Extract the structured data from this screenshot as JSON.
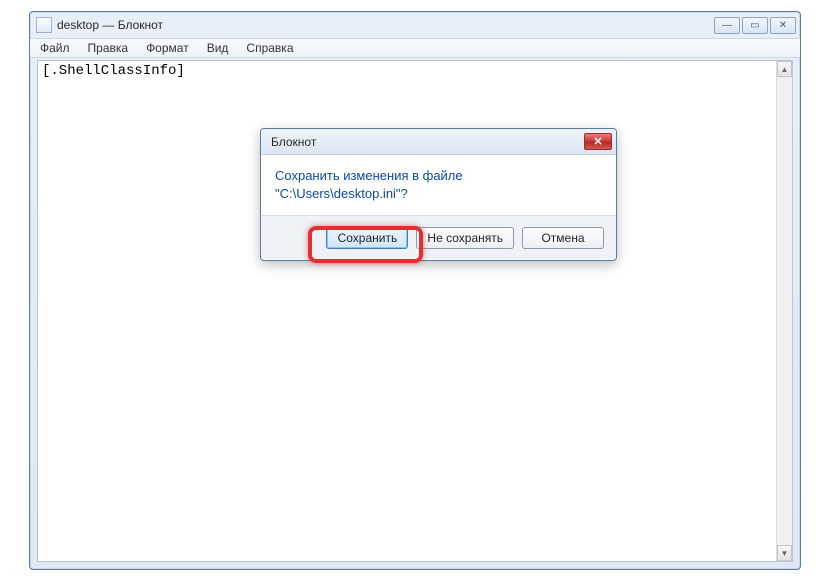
{
  "window": {
    "title": "desktop — Блокнот",
    "controls": {
      "min": "—",
      "max": "▭",
      "close": "✕"
    }
  },
  "menu": {
    "file": "Файл",
    "edit": "Правка",
    "format": "Формат",
    "view": "Вид",
    "help": "Справка"
  },
  "editor": {
    "content": "[.ShellClassInfo]"
  },
  "dialog": {
    "title": "Блокнот",
    "message_line1": "Сохранить изменения в файле",
    "message_line2": "\"C:\\Users\\desktop.ini\"?",
    "buttons": {
      "save": "Сохранить",
      "dontsave": "Не сохранять",
      "cancel": "Отмена"
    }
  }
}
